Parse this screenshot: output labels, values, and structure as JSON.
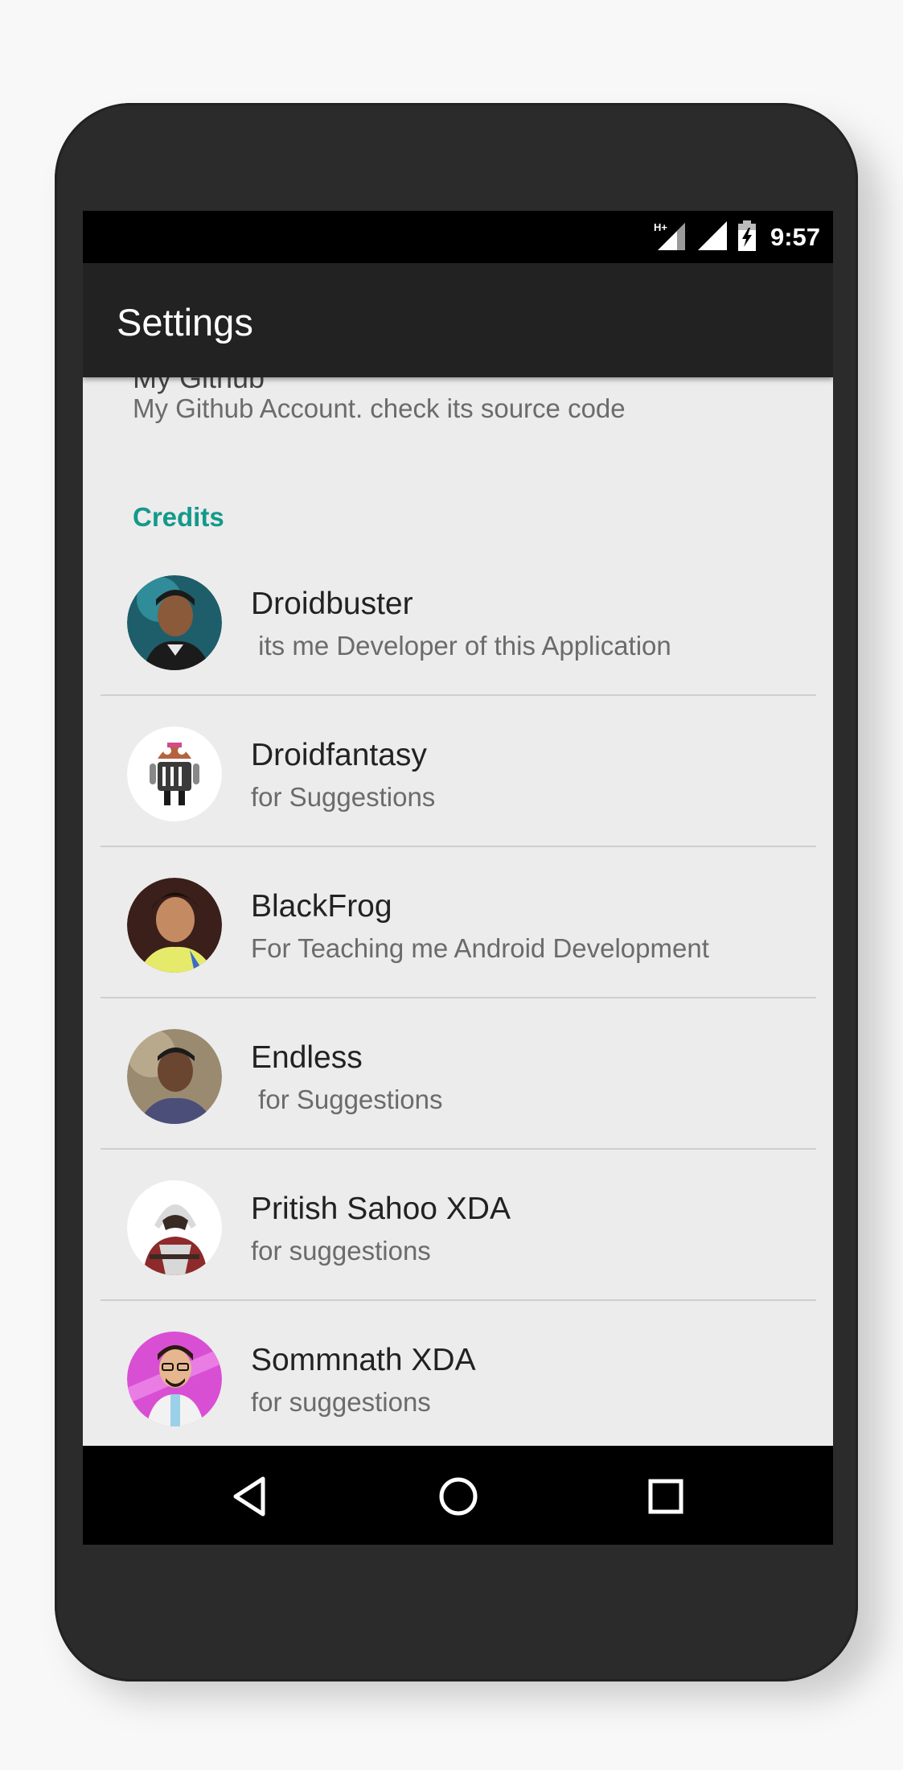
{
  "status_bar": {
    "network_label": "H+",
    "time": "9:57",
    "icons": [
      "hplus-signal-icon",
      "signal-icon",
      "battery-charging-icon"
    ]
  },
  "app_bar": {
    "title": "Settings"
  },
  "github": {
    "partial_title": "My Github",
    "summary": "My Github Account. check its source code"
  },
  "credits": {
    "category": "Credits",
    "items": [
      {
        "name": "Droidbuster",
        "summary": " its me Developer of this Application",
        "avatar": "avatar-droidbuster"
      },
      {
        "name": "Droidfantasy",
        "summary": "for Suggestions",
        "avatar": "avatar-droidfantasy"
      },
      {
        "name": "BlackFrog",
        "summary": "For Teaching me Android Development",
        "avatar": "avatar-blackfrog"
      },
      {
        "name": "Endless",
        "summary": " for Suggestions",
        "avatar": "avatar-endless"
      },
      {
        "name": "Pritish Sahoo XDA",
        "summary": "for suggestions",
        "avatar": "avatar-pritish"
      },
      {
        "name": "Sommnath XDA",
        "summary": "for suggestions",
        "avatar": "avatar-sommnath"
      }
    ]
  },
  "nav_bar": {
    "buttons": [
      "back-icon",
      "home-icon",
      "recents-icon"
    ]
  },
  "colors": {
    "accent": "#13998a",
    "app_bar": "#222222",
    "screen_background": "#ececec",
    "phone_body": "#2b2b2b"
  }
}
